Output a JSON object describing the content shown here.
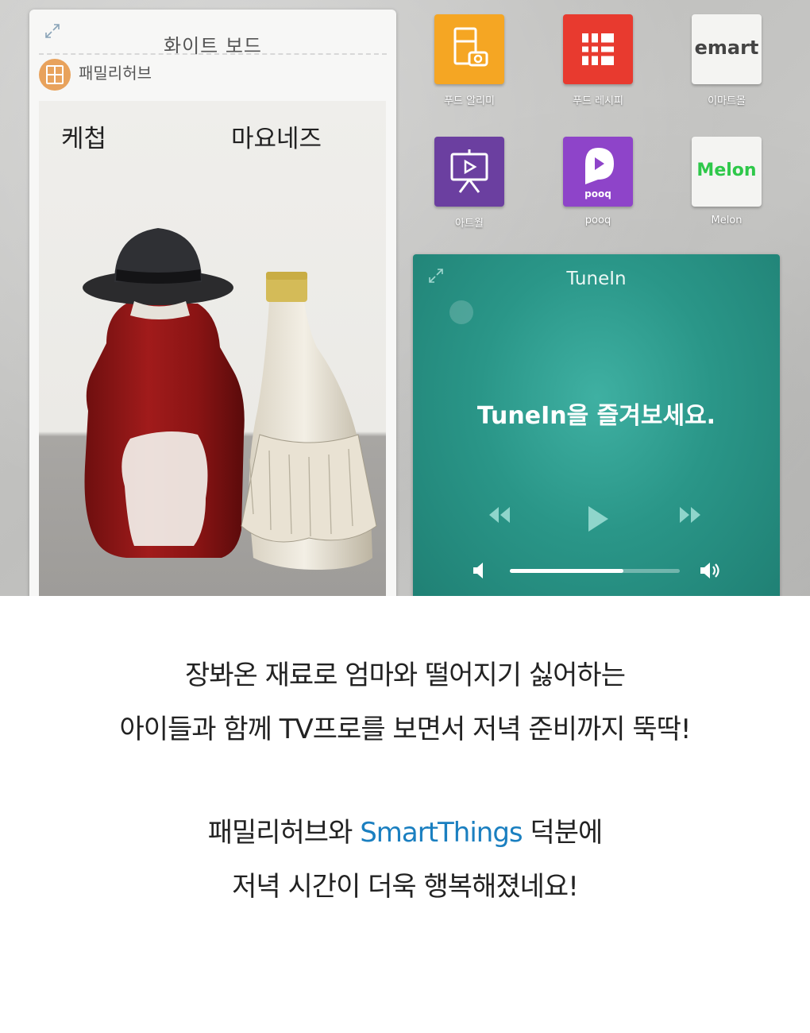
{
  "whiteboard": {
    "title": "화이트 보드",
    "app_name": "패밀리허브",
    "label_left": "케첩",
    "label_right": "마요네즈"
  },
  "apps": [
    {
      "label": "푸드 알리미",
      "color": "#f5a623"
    },
    {
      "label": "푸드 레시피",
      "color": "#e83a2f"
    },
    {
      "label": "이마트몰",
      "icon_text": "emart",
      "color": "#f4f4f2"
    },
    {
      "label": "아트월",
      "color": "#6b3fa0"
    },
    {
      "label": "pooq",
      "icon_text": "pooq",
      "color": "#8e44c9"
    },
    {
      "label": "Melon",
      "icon_text": "Melon",
      "color": "#f4f4f2"
    }
  ],
  "tunein": {
    "title": "TuneIn",
    "message": "TuneIn을 즐겨보세요.",
    "volume_level": 0.67
  },
  "caption": {
    "line1": "장봐온 재료로 엄마와 떨어지기 싫어하는",
    "line2": "아이들과 함께 TV프로를 보면서 저녁 준비까지 뚝딱!",
    "line3_prefix": "패밀리허브와 ",
    "line3_brand": "SmartThings",
    "line3_suffix": " 덕분에",
    "line4": "저녁 시간이 더욱 행복해졌네요!",
    "brand_color": "#1a7fc0"
  }
}
